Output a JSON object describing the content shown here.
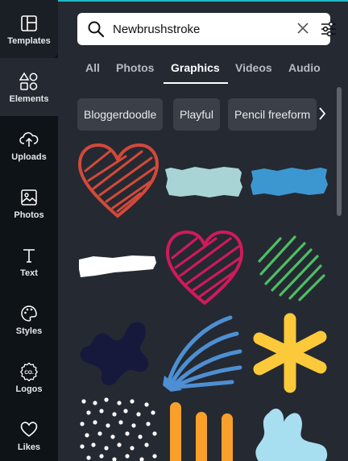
{
  "sidebar": {
    "items": [
      {
        "label": "Templates",
        "icon": "templates-icon"
      },
      {
        "label": "Elements",
        "icon": "elements-icon"
      },
      {
        "label": "Uploads",
        "icon": "uploads-icon"
      },
      {
        "label": "Photos",
        "icon": "photos-icon"
      },
      {
        "label": "Text",
        "icon": "text-icon"
      },
      {
        "label": "Styles",
        "icon": "styles-icon"
      },
      {
        "label": "Logos",
        "icon": "logos-icon"
      },
      {
        "label": "Likes",
        "icon": "likes-icon"
      }
    ],
    "logos_badge": "CO."
  },
  "search": {
    "value": "Newbrushstroke"
  },
  "tabs": [
    "All",
    "Photos",
    "Graphics",
    "Videos",
    "Audio"
  ],
  "active_tab": "Graphics",
  "chips": [
    "Bloggerdoodle",
    "Playful",
    "Pencil freeform"
  ],
  "graphics": [
    {
      "name": "red-scribble-heart-graphic",
      "color": "#d3493a"
    },
    {
      "name": "teal-brushstroke-graphic",
      "color": "#a8d4d6"
    },
    {
      "name": "blue-brushstroke-graphic",
      "color": "#3c97d0"
    },
    {
      "name": "white-brushstroke-graphic",
      "color": "#ffffff"
    },
    {
      "name": "pink-scribble-heart-graphic",
      "color": "#cf1a5b"
    },
    {
      "name": "green-diagonal-lines-graphic",
      "color": "#4cbf62"
    },
    {
      "name": "navy-blob-graphic",
      "color": "#16193b"
    },
    {
      "name": "blue-brush-fan-graphic",
      "color": "#4d8fd2"
    },
    {
      "name": "yellow-asterisk-graphic",
      "color": "#fcc93a"
    },
    {
      "name": "white-dots-graphic",
      "color": "#ffffff"
    },
    {
      "name": "orange-lines-graphic",
      "color": "#f8a02a"
    },
    {
      "name": "light-blue-blob-graphic",
      "color": "#a8dff0"
    }
  ]
}
